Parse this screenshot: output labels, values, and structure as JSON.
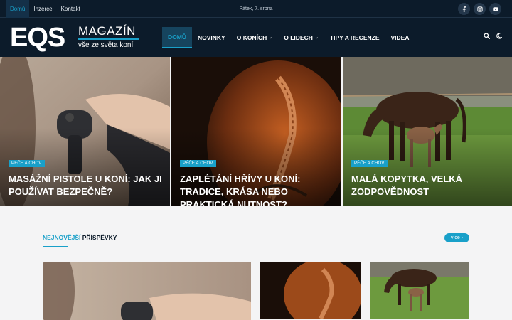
{
  "topbar": {
    "nav": [
      {
        "label": "Domů",
        "active": true
      },
      {
        "label": "Inzerce",
        "active": false
      },
      {
        "label": "Kontakt",
        "active": false
      }
    ],
    "date": "Pátek, 7. srpna",
    "social": [
      "facebook-icon",
      "instagram-icon",
      "youtube-icon"
    ]
  },
  "logo": {
    "main": "EQS",
    "title": "MAGAZÍN",
    "subtitle": "vše ze světa koní"
  },
  "nav": {
    "items": [
      {
        "label": "DOMŮ",
        "active": true,
        "dropdown": false
      },
      {
        "label": "NOVINKY",
        "active": false,
        "dropdown": false
      },
      {
        "label": "O KONÍCH",
        "active": false,
        "dropdown": true
      },
      {
        "label": "O LIDECH",
        "active": false,
        "dropdown": true
      },
      {
        "label": "TIPY A RECENZE",
        "active": false,
        "dropdown": false
      },
      {
        "label": "VIDEA",
        "active": false,
        "dropdown": false
      }
    ],
    "chevron": "⌄"
  },
  "hero": [
    {
      "tag": "PÉČE A CHOV",
      "title": "MASÁŽNÍ PISTOLE U KONÍ: JAK JI POUŽÍVAT BEZPEČNĚ?"
    },
    {
      "tag": "PÉČE A CHOV",
      "title": "ZAPLÉTÁNÍ HŘÍVY U KONÍ: TRADICE, KRÁSA NEBO PRAKTICKÁ NUTNOST?"
    },
    {
      "tag": "PÉČE A CHOV",
      "title": "MALÁ KOPYTKA, VELKÁ ZODPOVĚDNOST"
    }
  ],
  "section": {
    "title_accent": "NEJNOVĚJŠÍ",
    "title_rest": " PŘÍSPĚVKY",
    "more": "více ›"
  },
  "colors": {
    "navy": "#0c1b2a",
    "accent": "#19a0c9"
  }
}
